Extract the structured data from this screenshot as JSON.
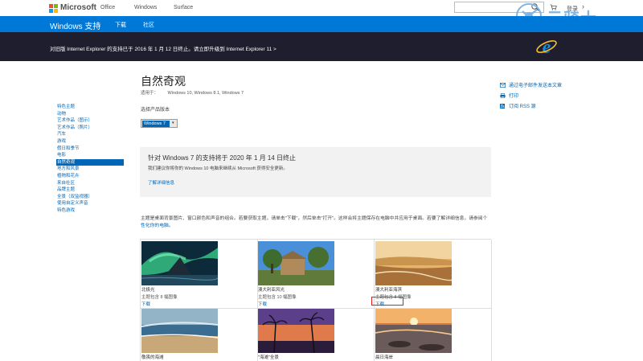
{
  "top": {
    "brand": "Microsoft",
    "nav": [
      "Office",
      "Windows",
      "Surface"
    ],
    "login": "登录"
  },
  "header": {
    "brand": "Windows 支持",
    "nav": [
      "下载",
      "社区"
    ]
  },
  "announcement": "对旧版 Internet Explorer 的支持已于 2016 年 1 月 12 日终止。请立即升级到 Internet Explorer 11 >",
  "watermark": "云骑士",
  "page": {
    "title": "自然奇观",
    "applies_label": "适用于：",
    "applies": "Windows 10, Windows 8.1, Windows 7",
    "select_label": "选择产品版本",
    "selected_version": "Windows 7"
  },
  "sidebar": {
    "items": [
      {
        "label": "特色主题"
      },
      {
        "label": "动物"
      },
      {
        "label": "艺术作品（图示）"
      },
      {
        "label": "艺术作品（照片）"
      },
      {
        "label": "汽车"
      },
      {
        "label": "游戏"
      },
      {
        "label": "假日和季节"
      },
      {
        "label": "电影"
      },
      {
        "label": "自然奇观",
        "active": true
      },
      {
        "label": "地方和风景"
      },
      {
        "label": "植物和花卉"
      },
      {
        "label": "来自社区"
      },
      {
        "label": "品牌主题"
      },
      {
        "label": "全景（双监视器）"
      },
      {
        "label": "使用自定义声音"
      },
      {
        "label": "特色游戏"
      }
    ]
  },
  "notice": {
    "title": "针对 Windows 7 的支持将于 2020 年 1 月 14 日终止",
    "subtitle": "我们建议你将你的 Windows 10 电脑来继续从 Microsoft 获得安全更新。",
    "link": "了解详细信息"
  },
  "intro": {
    "text": "主题是桌面背景图片、窗口颜色和声音的组合。若要获取主题，请单击\"下载\"，然后单击\"打开\"。这样会将主题保存在电脑中并应用于桌面。若要了解详细信息，请参阅",
    "link": "个性化你的电脑。"
  },
  "themes": [
    {
      "name": "北极光",
      "count": "主题包含 8 幅图像",
      "download": "下载"
    },
    {
      "name": "澳大利亚风光",
      "count": "主题包含 10 幅图像",
      "download": "下载"
    },
    {
      "name": "澳大利亚海滨",
      "count": "主题包含 8 幅图像",
      "download": "下载"
    },
    {
      "name": "敬畏的海滩",
      "count": "",
      "download": ""
    },
    {
      "name": "\"海滩\"全景",
      "count": "",
      "download": ""
    },
    {
      "name": "晨日海岸",
      "count": "",
      "download": ""
    }
  ],
  "right_links": [
    "通过电子邮件发送本文章",
    "打印",
    "订阅 RSS 源"
  ],
  "colors": {
    "accent": "#0078d7",
    "link": "#0067b8",
    "dark_bar": "#1e1e2e",
    "highlight": "#e01e1e"
  }
}
